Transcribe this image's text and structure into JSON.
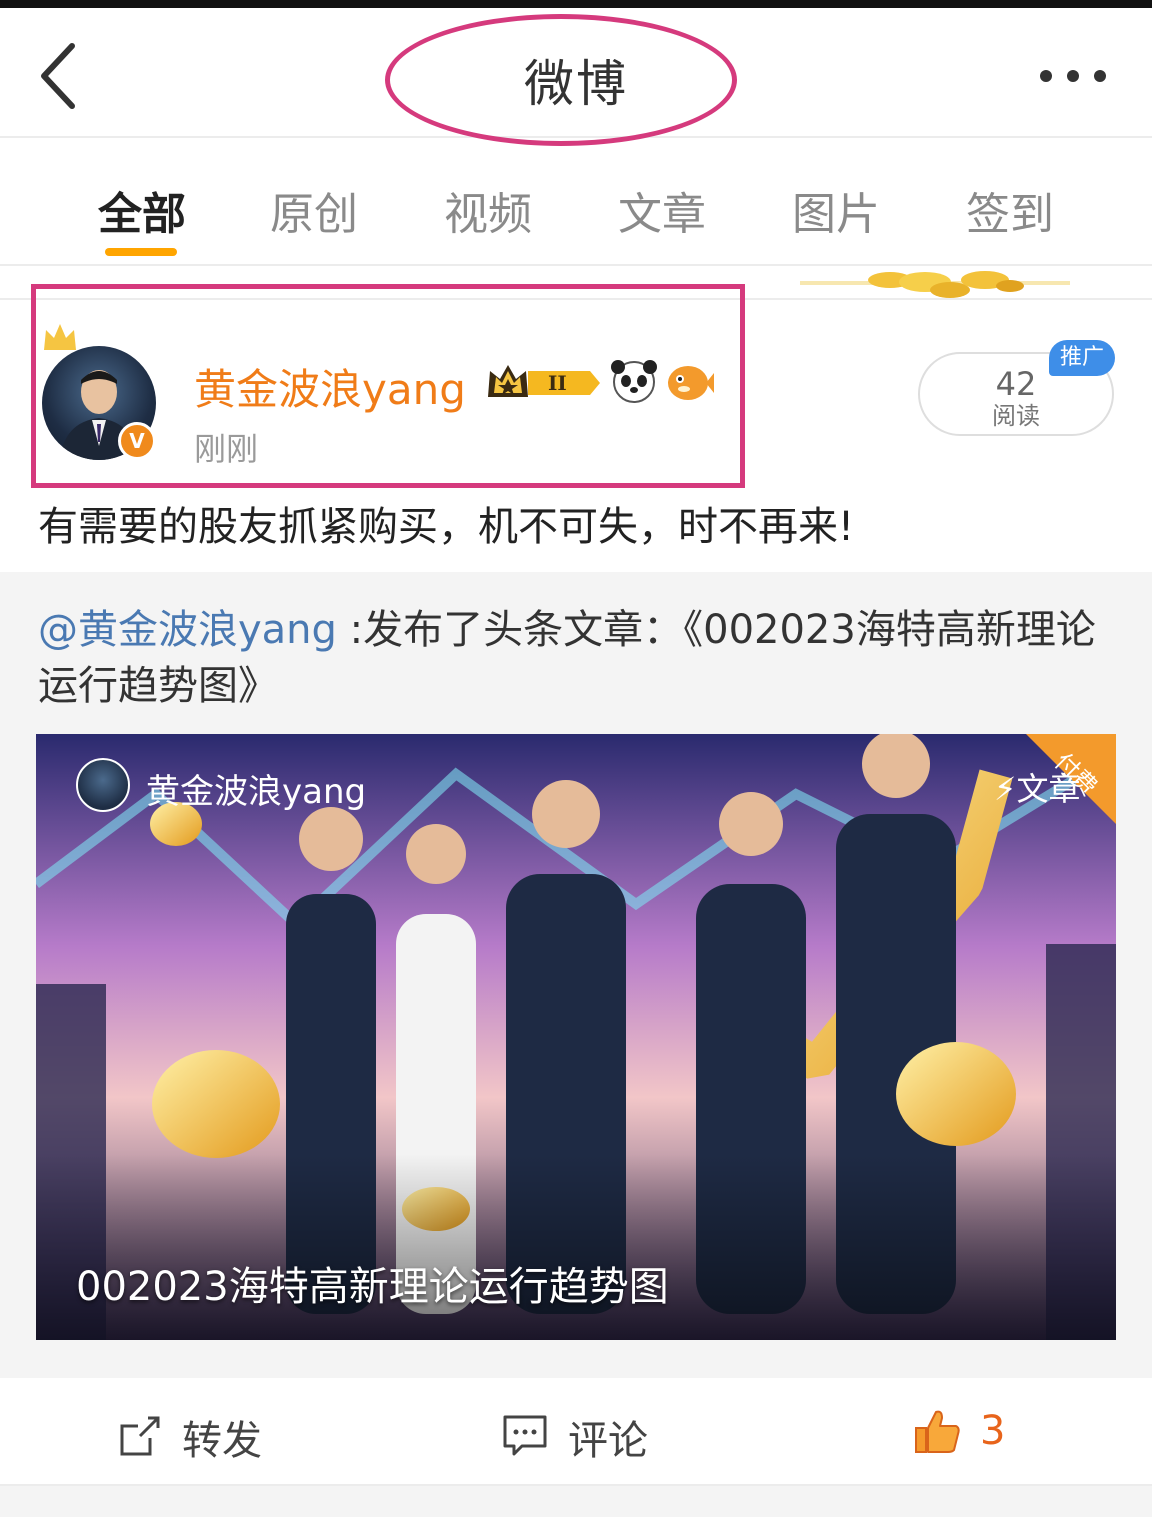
{
  "header": {
    "title": "微博",
    "back_icon": "chevron-left-icon",
    "more_icon": "more-dots-icon"
  },
  "tabs": [
    {
      "label": "全部",
      "active": true
    },
    {
      "label": "原创",
      "active": false
    },
    {
      "label": "视频",
      "active": false
    },
    {
      "label": "文章",
      "active": false
    },
    {
      "label": "图片",
      "active": false
    },
    {
      "label": "签到",
      "active": false
    }
  ],
  "post": {
    "username": "黄金波浪yang",
    "time": "刚刚",
    "verify_mark": "V",
    "badge_level": "II",
    "read_count": "42",
    "read_label": "阅读",
    "promo_label": "推广",
    "text": "有需要的股友抓紧购买，机不可失，时不再来!"
  },
  "repost": {
    "mention": "@黄金波浪yang",
    "text": " :发布了头条文章：《002023海特高新理论运行趋势图》",
    "card": {
      "author": "黄金波浪yang",
      "type_label": "文章",
      "paid_label": "付费",
      "caption": "002023海特高新理论运行趋势图"
    }
  },
  "actions": {
    "repost_label": "转发",
    "comment_label": "评论",
    "like_count": "3"
  },
  "colors": {
    "accent_orange": "#f07c18",
    "tab_underline": "#ffa500",
    "highlight_pink": "#d53a7d",
    "mention_blue": "#4a79b2",
    "promo_blue": "#3e8ee8"
  }
}
